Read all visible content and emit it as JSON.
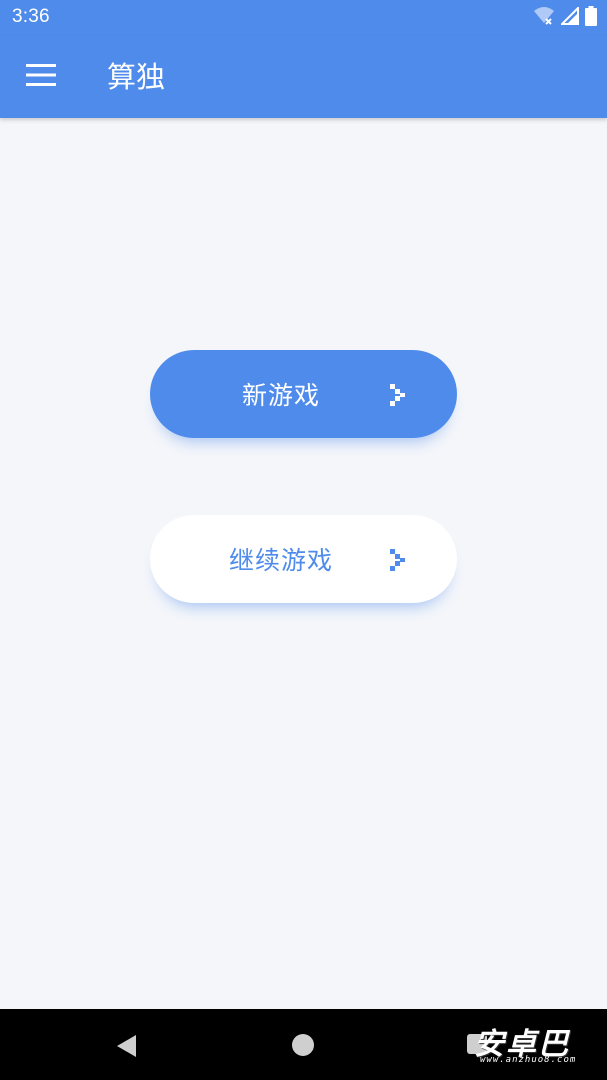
{
  "status_bar": {
    "time": "3:36",
    "icons": [
      "wifi-icon",
      "signal-icon",
      "battery-icon"
    ]
  },
  "app_bar": {
    "menu_icon": "menu-icon",
    "title": "算独"
  },
  "buttons": {
    "new_game": {
      "label": "新游戏",
      "icon": "chevron-right-icon"
    },
    "continue_game": {
      "label": "继续游戏",
      "icon": "chevron-right-icon"
    }
  },
  "nav_bar": {
    "icons": [
      "back-icon",
      "home-icon",
      "recents-icon"
    ]
  },
  "watermark": {
    "text": "安卓巴",
    "subtext": "www.anzhuo8.com"
  },
  "colors": {
    "accent": "#4f8bea",
    "background": "#f4f6fa",
    "white": "#ffffff",
    "nav_background": "#000000"
  }
}
